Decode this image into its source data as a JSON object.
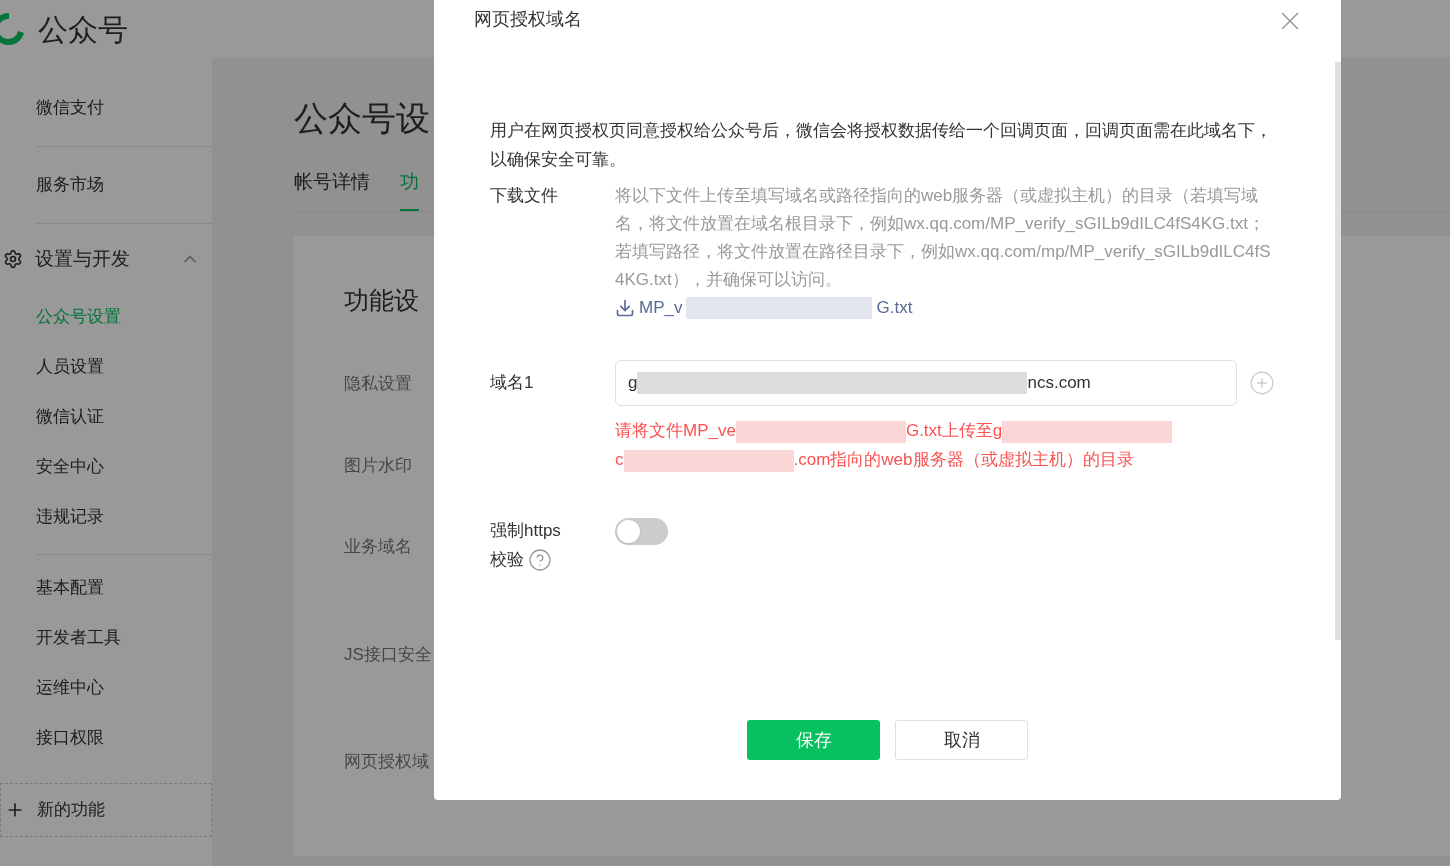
{
  "header": {
    "title": "公众号"
  },
  "sidebar": {
    "groups": [
      {
        "items": [
          {
            "label": "微信支付"
          }
        ]
      },
      {
        "items": [
          {
            "label": "服务市场"
          }
        ]
      }
    ],
    "section": {
      "label": "设置与开发",
      "expanded": true,
      "groups": [
        {
          "items": [
            {
              "label": "公众号设置",
              "selected": true
            },
            {
              "label": "人员设置",
              "selected": false
            },
            {
              "label": "微信认证",
              "selected": false
            },
            {
              "label": "安全中心",
              "selected": false
            },
            {
              "label": "违规记录",
              "selected": false
            }
          ]
        },
        {
          "items": [
            {
              "label": "基本配置",
              "selected": false
            },
            {
              "label": "开发者工具",
              "selected": false
            },
            {
              "label": "运维中心",
              "selected": false
            },
            {
              "label": "接口权限",
              "selected": false
            }
          ]
        }
      ]
    },
    "new_feature": {
      "label": "新的功能"
    }
  },
  "main": {
    "title": "公众号设",
    "tabs": [
      {
        "label": "帐号详情",
        "selected": false
      },
      {
        "label": "功",
        "selected": true
      }
    ],
    "card": {
      "title": "功能设",
      "rows": [
        {
          "label": "隐私设置"
        },
        {
          "label": "图片水印"
        },
        {
          "label": "业务域名"
        },
        {
          "label": "JS接口安全"
        },
        {
          "label": "网页授权域"
        }
      ]
    }
  },
  "dialog": {
    "title": "网页授权域名",
    "intro": "用户在网页授权页同意授权给公众号后，微信会将授权数据传给一个回调页面，回调页面需在此域名下，以确保安全可靠。",
    "download": {
      "label": "下载文件",
      "description": "将以下文件上传至填写域名或路径指向的web服务器（或虚拟主机）的目录（若填写域名，将文件放置在域名根目录下，例如wx.qq.com/MP_verify_sGILb9dILC4fS4KG.txt；若填写路径，将文件放置在路径目录下，例如wx.qq.com/mp/MP_verify_sGILb9dILC4fS4KG.txt），并确保可以访问。",
      "file": [
        {
          "kind": "text",
          "text": "MP_v"
        },
        {
          "kind": "redacted"
        },
        {
          "kind": "text",
          "text": "G.txt"
        }
      ]
    },
    "domain": {
      "label": "域名1",
      "value": [
        {
          "kind": "text",
          "text": "g"
        },
        {
          "kind": "redacted"
        },
        {
          "kind": "text",
          "text": "ncs.com"
        }
      ],
      "error_lines": [
        [
          {
            "kind": "text",
            "text": "请将文件MP_ve"
          },
          {
            "kind": "redacted"
          },
          {
            "kind": "text",
            "text": "G.txt上传至g"
          },
          {
            "kind": "redacted"
          }
        ],
        [
          {
            "kind": "text",
            "text": "c"
          },
          {
            "kind": "redacted"
          },
          {
            "kind": "text",
            "text": ".com指向的web服务器（或虚拟主机）的目录"
          }
        ]
      ]
    },
    "https": {
      "label_lines": [
        "强制https",
        "校验"
      ],
      "on": false
    },
    "buttons": [
      {
        "label": "保存",
        "kind": "primary"
      },
      {
        "label": "取消",
        "kind": "default"
      }
    ]
  }
}
